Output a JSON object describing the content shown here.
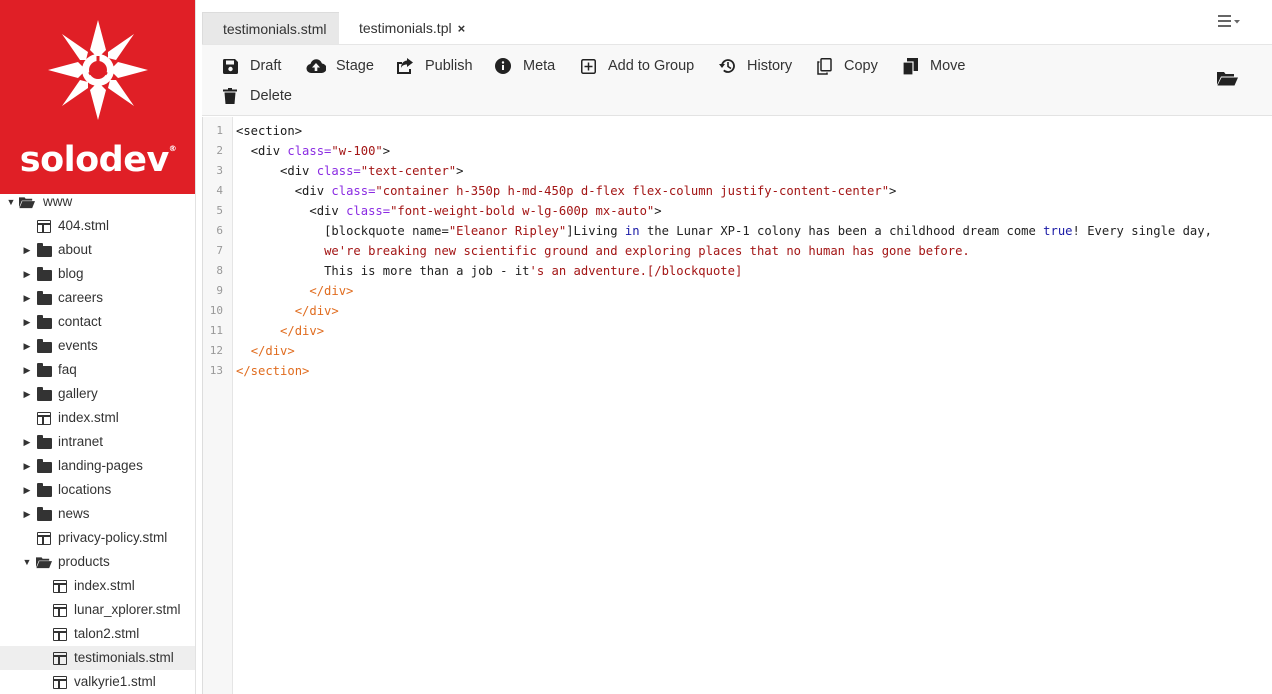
{
  "brand": {
    "name": "solodev",
    "registered": "®",
    "color": "#e01f26"
  },
  "tabs": [
    {
      "label": "testimonials.stml",
      "active": false
    },
    {
      "label": "testimonials.tpl",
      "active": true,
      "close": "×"
    }
  ],
  "toolbar": {
    "draft": "Draft",
    "stage": "Stage",
    "publish": "Publish",
    "meta": "Meta",
    "add_to_group": "Add to Group",
    "history": "History",
    "copy": "Copy",
    "move": "Move",
    "delete": "Delete"
  },
  "tree": {
    "root": "www",
    "items": [
      {
        "label": "404.stml",
        "type": "file"
      },
      {
        "label": "about",
        "type": "folder"
      },
      {
        "label": "blog",
        "type": "folder"
      },
      {
        "label": "careers",
        "type": "folder"
      },
      {
        "label": "contact",
        "type": "folder"
      },
      {
        "label": "events",
        "type": "folder"
      },
      {
        "label": "faq",
        "type": "folder"
      },
      {
        "label": "gallery",
        "type": "folder"
      },
      {
        "label": "index.stml",
        "type": "file"
      },
      {
        "label": "intranet",
        "type": "folder"
      },
      {
        "label": "landing-pages",
        "type": "folder"
      },
      {
        "label": "locations",
        "type": "folder"
      },
      {
        "label": "news",
        "type": "folder"
      },
      {
        "label": "privacy-policy.stml",
        "type": "file"
      },
      {
        "label": "products",
        "type": "folder-open"
      }
    ],
    "products_children": [
      {
        "label": "index.stml"
      },
      {
        "label": "lunar_xplorer.stml"
      },
      {
        "label": "talon2.stml"
      },
      {
        "label": "testimonials.stml",
        "selected": true
      },
      {
        "label": "valkyrie1.stml"
      }
    ]
  },
  "editor": {
    "line_numbers": [
      "1",
      "2",
      "3",
      "4",
      "5",
      "6",
      "7",
      "8",
      "9",
      "10",
      "11",
      "12",
      "13"
    ],
    "lines": {
      "l1_open": "<section>",
      "l2_open": "<div ",
      "l2_attr": "class=",
      "l2_val": "\"w-100\"",
      "l2_close": ">",
      "l3_open": "<div ",
      "l3_attr": "class=",
      "l3_val": "\"text-center\"",
      "l3_close": ">",
      "l4_open": "<div ",
      "l4_attr": "class=",
      "l4_val": "\"container h-350p h-md-450p d-flex flex-column justify-content-center\"",
      "l4_close": ">",
      "l5_open": "<div ",
      "l5_attr": "class=",
      "l5_val": "\"font-weight-bold w-lg-600p mx-auto\"",
      "l5_close": ">",
      "l6_a": "[blockquote name=",
      "l6_b": "\"Eleanor Ripley\"",
      "l6_c": "]Living ",
      "l6_d": "in",
      "l6_e": " the Lunar XP-1 colony has been a childhood dream come ",
      "l6_f": "true",
      "l6_g": "! Every single day,",
      "l7": "we're breaking new scientific ground and exploring places that no human has gone before.",
      "l8_a": "This is more than a job - it",
      "l8_b": "'s an adventure.[/blockquote]",
      "l9": "</div>",
      "l10": "</div>",
      "l11": "</div>",
      "l12": "</div>",
      "l13": "</section>"
    }
  }
}
